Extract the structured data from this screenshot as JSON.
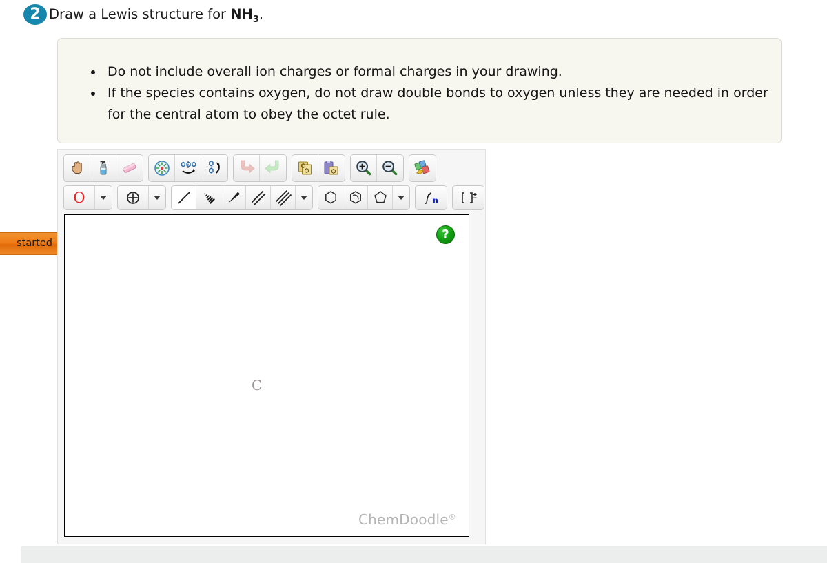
{
  "question": {
    "number": "2",
    "prompt_prefix": "Draw a Lewis structure for ",
    "formula_main": "NH",
    "formula_sub": "3",
    "prompt_suffix": "."
  },
  "instructions": {
    "items": [
      "Do not include overall ion charges or formal charges in your drawing.",
      "If the species contains oxygen, do not draw double bonds to oxygen unless they are needed in order for the central atom to obey the octet rule."
    ]
  },
  "side_tab": {
    "label": "started"
  },
  "sketcher": {
    "toolbar_row_1": [
      {
        "name": "hand-tool",
        "icon": "hand-icon",
        "title": "Move / Pan",
        "selected": false
      },
      {
        "name": "clear-tool",
        "icon": "spray-bottle-icon",
        "title": "Clear",
        "selected": false
      },
      {
        "name": "eraser-tool",
        "icon": "eraser-icon",
        "title": "Erase",
        "selected": false
      },
      {
        "name": "optimize-tool",
        "icon": "center-target-icon",
        "title": "Clean / Optimize",
        "selected": false
      },
      {
        "name": "flip-tool",
        "icon": "flip-horizontal-icon",
        "title": "Flip",
        "selected": false
      },
      {
        "name": "rotate-tool",
        "icon": "rotate-icon",
        "title": "Rotate",
        "selected": false
      },
      {
        "name": "undo-tool",
        "icon": "undo-arrow-icon",
        "title": "Undo",
        "selected": false
      },
      {
        "name": "redo-tool",
        "icon": "redo-arrow-icon",
        "title": "Redo",
        "selected": false
      },
      {
        "name": "copy-tool",
        "icon": "copy-icon",
        "title": "Copy",
        "selected": false
      },
      {
        "name": "paste-tool",
        "icon": "paste-clipboard-icon",
        "title": "Paste",
        "selected": false
      },
      {
        "name": "zoom-in-tool",
        "icon": "magnifier-plus-icon",
        "title": "Zoom In",
        "selected": false
      },
      {
        "name": "zoom-out-tool",
        "icon": "magnifier-minus-icon",
        "title": "Zoom Out",
        "selected": false
      },
      {
        "name": "template-tool",
        "icon": "colored-shapes-icon",
        "title": "Templates",
        "selected": false
      }
    ],
    "element_button": {
      "label": "O",
      "color": "#ee2222"
    },
    "charge_button": {
      "icon": "circled-plus-icon"
    },
    "bond_buttons": [
      {
        "name": "single-bond-tool",
        "icon": "single-bond-icon",
        "selected": true
      },
      {
        "name": "hash-bond-tool",
        "icon": "hashed-wedge-bond-icon",
        "selected": false
      },
      {
        "name": "wedge-bond-tool",
        "icon": "solid-wedge-bond-icon",
        "selected": false
      },
      {
        "name": "double-bond-tool",
        "icon": "double-bond-icon",
        "selected": false
      },
      {
        "name": "triple-bond-tool",
        "icon": "triple-bond-icon",
        "selected": false
      }
    ],
    "ring_buttons": [
      {
        "name": "benzene-ring-tool",
        "icon": "hexagon-icon",
        "selected": false
      },
      {
        "name": "aromatic-ring-tool",
        "icon": "aromatic-hexagon-icon",
        "selected": false
      },
      {
        "name": "cyclopentane-ring-tool",
        "icon": "pentagon-icon",
        "selected": false
      }
    ],
    "misc_buttons": [
      {
        "name": "repeat-unit-tool",
        "icon": "polymer-n-icon",
        "label": "n"
      },
      {
        "name": "bracket-charge-tool",
        "icon": "bracket-charge-icon",
        "label": "[ ]"
      }
    ],
    "canvas": {
      "atom_label": "C",
      "help_label": "?",
      "watermark": "ChemDoodle",
      "watermark_mark": "®"
    }
  }
}
